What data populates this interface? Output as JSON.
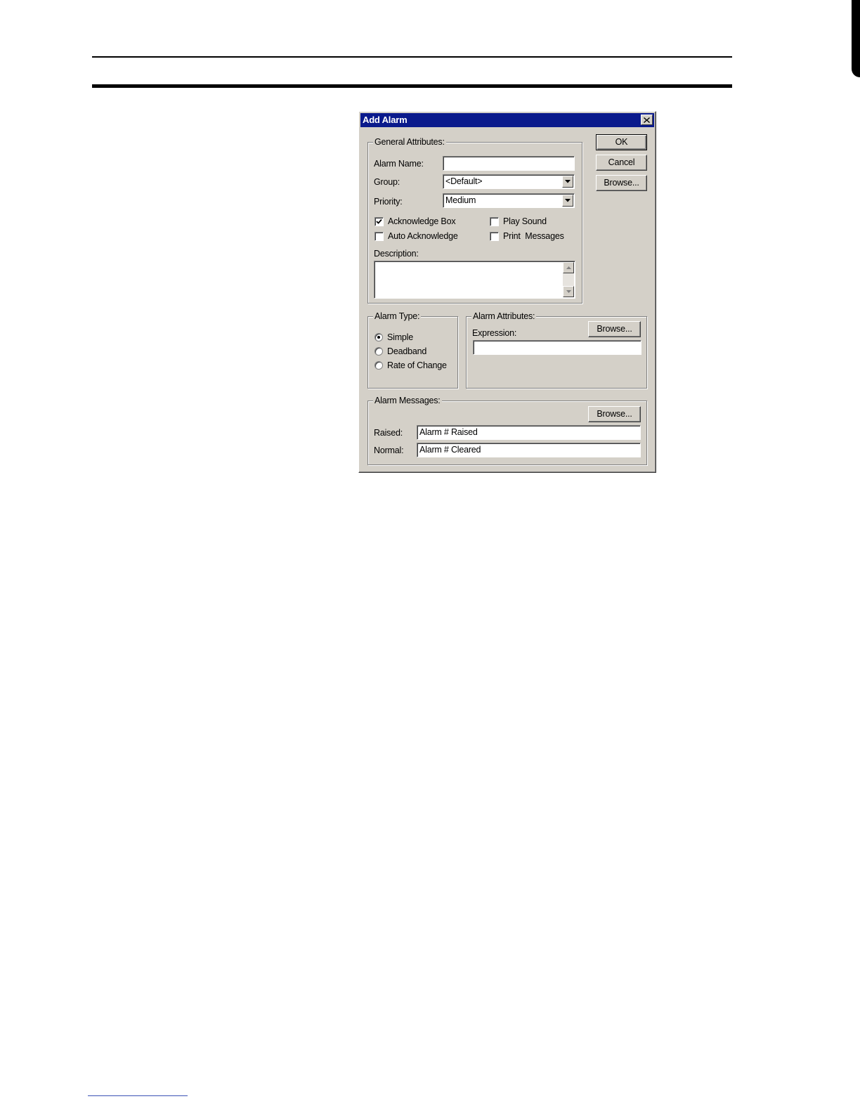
{
  "dialog": {
    "title": "Add Alarm",
    "buttons": {
      "ok": "OK",
      "cancel": "Cancel",
      "browse": "Browse..."
    },
    "general": {
      "legend": "General Attributes:",
      "alarm_name_label": "Alarm Name:",
      "alarm_name_value": "",
      "group_label": "Group:",
      "group_value": "<Default>",
      "priority_label": "Priority:",
      "priority_value": "Medium",
      "checkboxes": [
        {
          "label": "Acknowledge Box",
          "checked": true
        },
        {
          "label": "Play Sound",
          "checked": false
        },
        {
          "label": "Auto Acknowledge",
          "checked": false
        },
        {
          "label": "Print  Messages",
          "checked": false
        }
      ],
      "description_label": "Description:",
      "description_value": ""
    },
    "alarm_type": {
      "legend": "Alarm Type:",
      "options": [
        "Simple",
        "Deadband",
        "Rate of Change"
      ],
      "selected": "Simple"
    },
    "alarm_attributes": {
      "legend": "Alarm Attributes:",
      "expression_label": "Expression:",
      "expression_value": "",
      "browse": "Browse..."
    },
    "alarm_messages": {
      "legend": "Alarm Messages:",
      "browse": "Browse...",
      "raised_label": "Raised:",
      "raised_value": "Alarm # Raised",
      "normal_label": "Normal:",
      "normal_value": "Alarm # Cleared"
    }
  }
}
